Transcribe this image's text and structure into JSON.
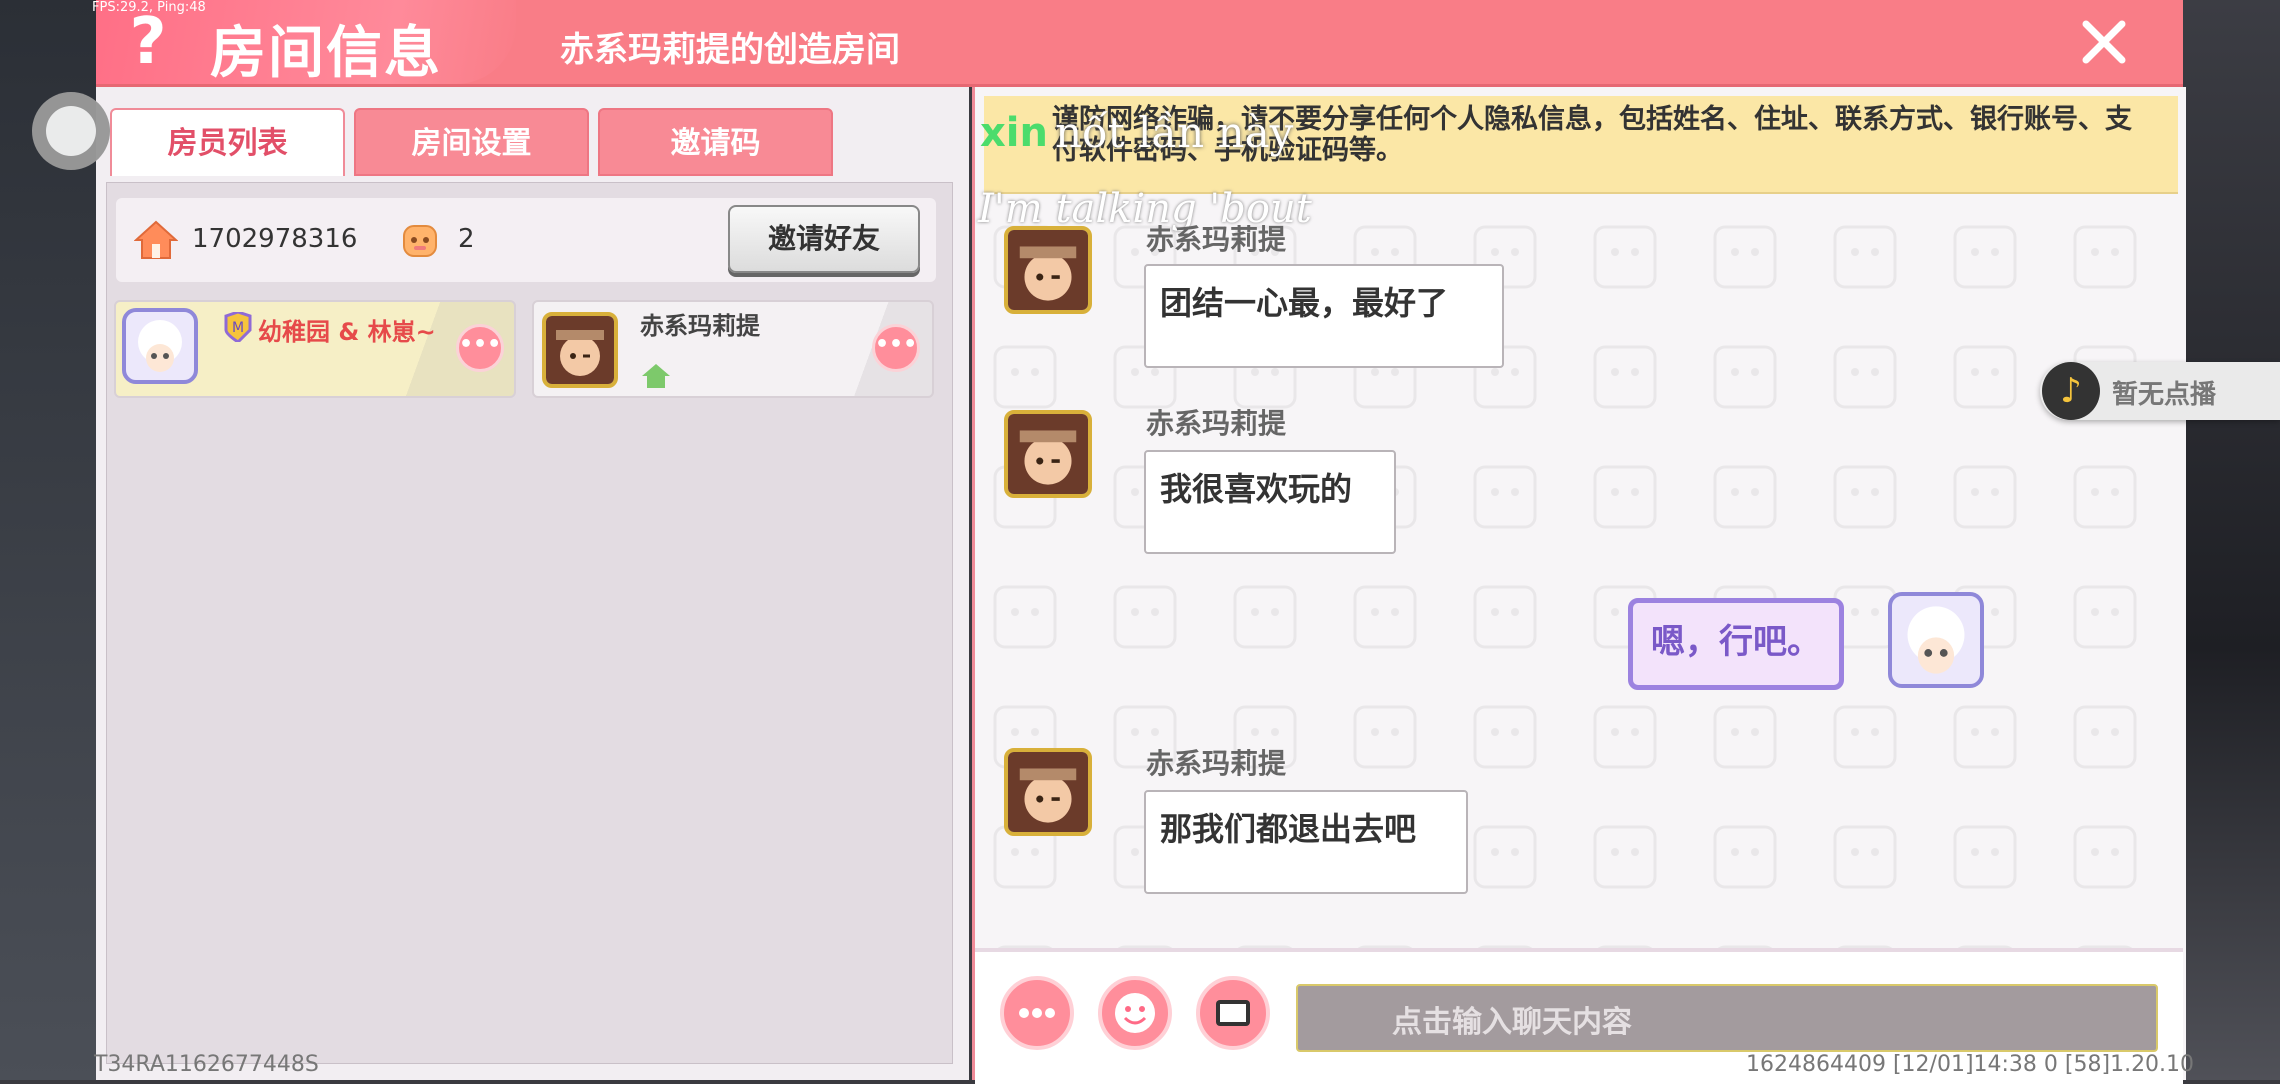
{
  "debug": {
    "fps_text": "FPS:29.2, Ping:48"
  },
  "header": {
    "title": "房间信息",
    "room_name": "赤系玛莉提的创造房间"
  },
  "tabs": [
    {
      "label": "房员列表",
      "active": true
    },
    {
      "label": "房间设置",
      "active": false
    },
    {
      "label": "邀请码",
      "active": false
    }
  ],
  "room": {
    "id": "1702978316",
    "member_count": "2",
    "invite_button": "邀请好友"
  },
  "members": [
    {
      "name": "幼稚园 & 林崽~"
    },
    {
      "name": "赤系玛莉提"
    }
  ],
  "warning": {
    "text": "谨防网络诈骗，请不要分享任何个人隐私信息，包括姓名、住址、联系方式、银行账号、支付软件密码、手机验证码等。"
  },
  "overlay": {
    "green": "xin",
    "white": "nốt lần này",
    "script": "I'm talking 'bout"
  },
  "messages": [
    {
      "sender": "赤系玛莉提",
      "text": "团结一心最，最好了"
    },
    {
      "sender": "赤系玛莉提",
      "text": "我很喜欢玩的"
    },
    {
      "sender": "me",
      "text": "嗯，行吧。"
    },
    {
      "sender": "赤系玛莉提",
      "text": "那我们都退出去吧"
    }
  ],
  "music": {
    "text": "暂无点播"
  },
  "chat_input": {
    "placeholder": "点击输入聊天内容"
  },
  "footer": {
    "left": "T34RA1162677448S",
    "right": "1624864409   [12/01]14:38 0   [58]1.20.10"
  },
  "colors": {
    "header": "#f97d87",
    "accent": "#e24f68",
    "warning_bg": "#fbe7a6",
    "button_pink": "#ff8e9b"
  }
}
